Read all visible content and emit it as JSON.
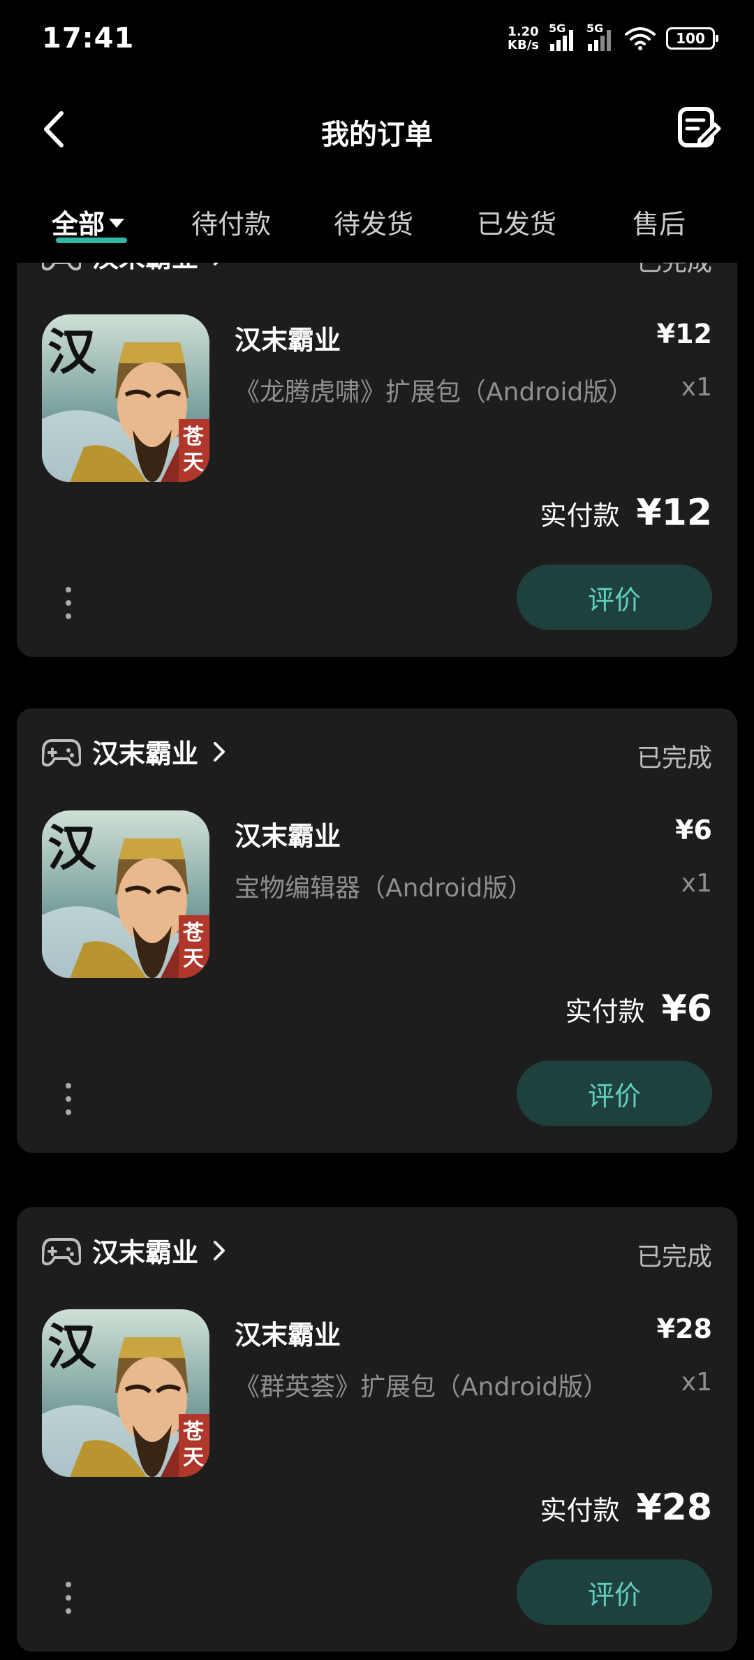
{
  "status_bar": {
    "time": "17:41",
    "net_speed_value": "1.20",
    "net_speed_unit": "KB/s",
    "sim1_label": "5G",
    "sim2_label": "5G",
    "battery": "100"
  },
  "header": {
    "title": "我的订单",
    "back_icon": "chevron-left-icon",
    "edit_icon": "edit-note-icon"
  },
  "tabs": [
    {
      "label": "全部",
      "active": true
    },
    {
      "label": "待付款",
      "active": false
    },
    {
      "label": "待发货",
      "active": false
    },
    {
      "label": "已发货",
      "active": false
    },
    {
      "label": "售后",
      "active": false
    }
  ],
  "accent_color": "#2fb8a5",
  "orders": [
    {
      "store": "汉末霸业",
      "status": "已完成",
      "product_title": "汉末霸业",
      "price": "¥12",
      "description": "《龙腾虎啸》扩展包（Android版）",
      "quantity": "x1",
      "paid_label": "实付款",
      "paid_amount": "¥12",
      "review_label": "评价"
    },
    {
      "store": "汉末霸业",
      "status": "已完成",
      "product_title": "汉末霸业",
      "price": "¥6",
      "description": "宝物编辑器（Android版）",
      "quantity": "x1",
      "paid_label": "实付款",
      "paid_amount": "¥6",
      "review_label": "评价"
    },
    {
      "store": "汉末霸业",
      "status": "已完成",
      "product_title": "汉末霸业",
      "price": "¥28",
      "description": "《群英荟》扩展包（Android版）",
      "quantity": "x1",
      "paid_label": "实付款",
      "paid_amount": "¥28",
      "review_label": "评价"
    }
  ],
  "product_art": {
    "big_char": "汉",
    "seal_chars": [
      "苍",
      "天"
    ]
  }
}
